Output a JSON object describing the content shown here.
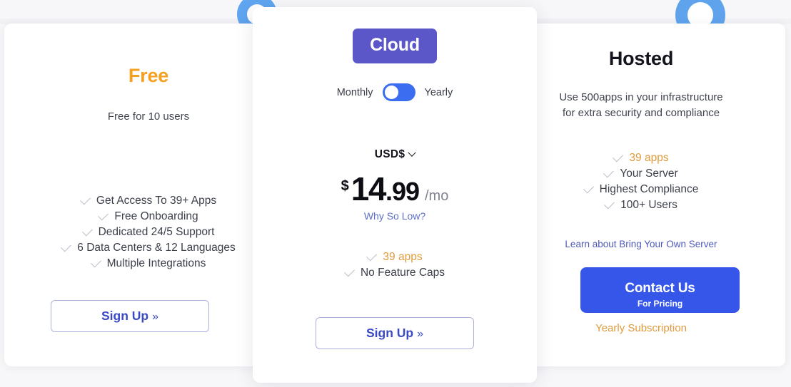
{
  "plans": {
    "free": {
      "title": "Free",
      "subtitle": "Free for 10 users",
      "features": [
        "Get Access To 39+ Apps",
        "Free Onboarding",
        "Dedicated 24/5 Support",
        "6 Data Centers & 12 Languages",
        "Multiple Integrations"
      ],
      "cta": "Sign Up",
      "cta_arrows": "»"
    },
    "cloud": {
      "badge": "Cloud",
      "billing_monthly": "Monthly",
      "billing_yearly": "Yearly",
      "billing_selected": "Monthly",
      "currency": "USD$",
      "currency_caret": "chevron-down-icon",
      "price_currency_symbol": "$",
      "price_integer": "14",
      "price_decimal": ".99",
      "price_period": "/mo",
      "why_link": "Why So Low?",
      "features": [
        {
          "label": "39 apps",
          "highlight": true
        },
        {
          "label": "No Feature Caps",
          "highlight": false
        }
      ],
      "cta": "Sign Up",
      "cta_arrows": "»"
    },
    "hosted": {
      "title": "Hosted",
      "subtitle_line1": "Use 500apps in your infrastructure",
      "subtitle_line2": "for extra security and compliance",
      "features": [
        {
          "label": "39 apps",
          "highlight": true
        },
        {
          "label": "Your Server",
          "highlight": false
        },
        {
          "label": "Highest Compliance",
          "highlight": false
        },
        {
          "label": "100+ Users",
          "highlight": false
        }
      ],
      "learn_link": "Learn about Bring Your Own Server",
      "cta_main": "Contact Us",
      "cta_sub": "For Pricing",
      "footer_link": "Yearly Subscription"
    }
  },
  "colors": {
    "accent_orange": "#f5a020",
    "accent_blue": "#3556e8",
    "cloud_purple": "#5b57c8",
    "link_blue": "#5b6fc4",
    "check_gray": "#b9bdc6",
    "toggle_blue": "#3a6df0"
  }
}
